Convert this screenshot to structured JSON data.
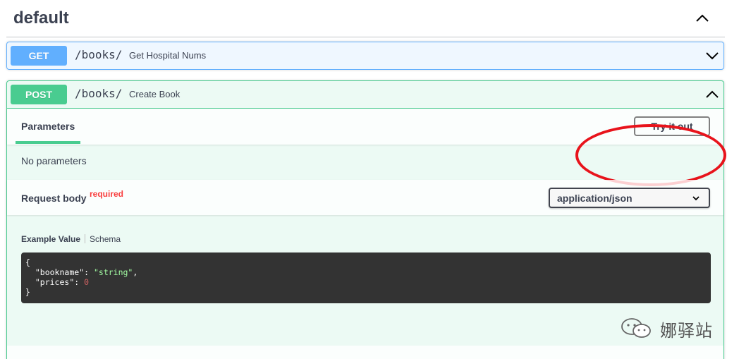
{
  "section": {
    "title": "default"
  },
  "operations": [
    {
      "method": "GET",
      "path": "/books/",
      "summary": "Get Hospital Nums"
    },
    {
      "method": "POST",
      "path": "/books/",
      "summary": "Create Book",
      "parameters_tab": "Parameters",
      "try_it_out": "Try it out",
      "no_parameters": "No parameters",
      "request_body_label": "Request body",
      "required_label": "required",
      "content_type": "application/json",
      "example_tab": "Example Value",
      "schema_tab": "Schema",
      "example": {
        "open": "{",
        "key1": "\"bookname\"",
        "val1": "\"string\"",
        "key2": "\"prices\"",
        "val2": "0",
        "close": "}"
      }
    }
  ],
  "watermark": {
    "text": "娜驿站"
  },
  "colors": {
    "get": "#61affe",
    "post": "#49cc90",
    "highlight": "#e8131b",
    "required": "#f93e3e",
    "code_bg": "#333333"
  },
  "icons": {
    "section_toggle": "chevron-up-icon",
    "get_toggle": "chevron-down-icon",
    "post_toggle": "chevron-up-icon",
    "select_arrow": "chevron-down-icon",
    "watermark": "wechat-icon"
  }
}
